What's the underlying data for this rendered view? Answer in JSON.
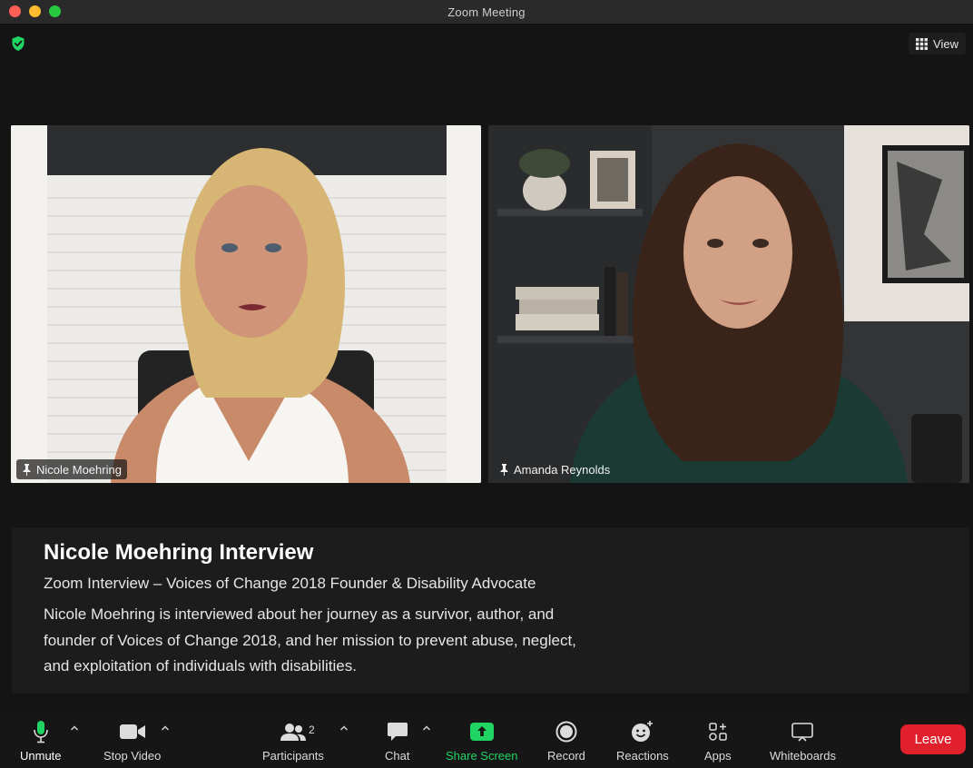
{
  "window": {
    "title": "Zoom Meeting"
  },
  "header": {
    "view_label": "View"
  },
  "participants_tiles": [
    {
      "name": "Nicole Moehring"
    },
    {
      "name": "Amanda Reynolds"
    }
  ],
  "caption": {
    "title": "Nicole Moehring Interview",
    "subtitle": "Zoom Interview – Voices of Change 2018 Founder & Disability Advocate",
    "description": "Nicole Moehring is interviewed about her journey as a survivor, author, and founder of Voices of Change 2018, and her mission to prevent abuse, neglect, and exploitation of individuals with disabilities."
  },
  "toolbar": {
    "unmute": "Unmute",
    "stop_video": "Stop Video",
    "participants": "Participants",
    "participant_count": "2",
    "chat": "Chat",
    "share_screen": "Share Screen",
    "record": "Record",
    "reactions": "Reactions",
    "apps": "Apps",
    "whiteboards": "Whiteboards",
    "leave": "Leave"
  },
  "colors": {
    "accent_green": "#1fd463",
    "leave_red": "#e0212b",
    "background": "#141414"
  },
  "icons": {
    "security": "shield-icon",
    "view": "grid-icon",
    "pin": "pin-icon",
    "mic": "microphone-icon",
    "video": "video-camera-icon",
    "participants": "people-icon",
    "chat": "chat-bubble-icon",
    "share": "share-arrow-icon",
    "record": "record-icon",
    "reactions": "smiley-plus-icon",
    "apps": "apps-icon",
    "whiteboards": "whiteboard-icon"
  }
}
